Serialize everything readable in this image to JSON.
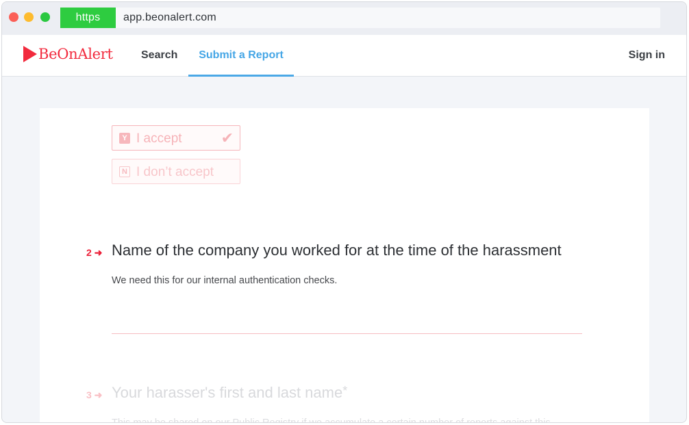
{
  "browser": {
    "protocol": "https",
    "url": "app.beonalert.com"
  },
  "nav": {
    "brand": "BeOnAlert",
    "search": "Search",
    "submit_report": "Submit a Report",
    "sign_in": "Sign in"
  },
  "form": {
    "consent": {
      "accept_key": "Y",
      "accept_label": "I accept",
      "decline_key": "N",
      "decline_label": "I don’t accept"
    },
    "q2": {
      "number": "2 ➜",
      "title": "Name of the company you worked for at the time of the harassment",
      "description": "We need this for our internal authentication checks.",
      "value": ""
    },
    "q3": {
      "number": "3 ➜",
      "title": "Your harasser's first and last name",
      "required_mark": "*",
      "description": "This may be shared on our Public Registry if we accumulate a certain number of reports against this"
    }
  },
  "colors": {
    "brand": "#f22a3d",
    "nav_active": "#45a6e6",
    "https_badge": "#2ecc40",
    "accent_line": "#f7bcc1"
  },
  "icons": {
    "logo": "play-triangle-icon",
    "check": "check-icon"
  }
}
